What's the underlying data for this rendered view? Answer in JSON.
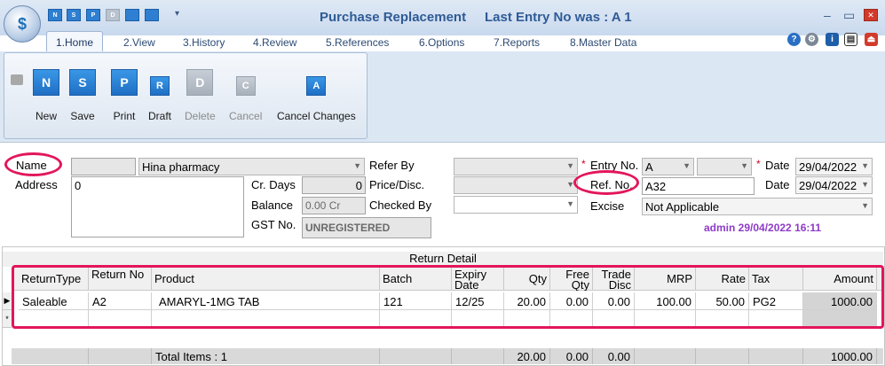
{
  "window": {
    "title": "Purchase Replacement",
    "last_entry": "Last Entry No was : A 1",
    "minimize": "–",
    "restore": "▭",
    "close": "✕"
  },
  "quick_access": [
    "N",
    "S",
    "P",
    "D",
    "",
    ""
  ],
  "tabs": [
    {
      "label": "1.Home",
      "active": true
    },
    {
      "label": "2.View"
    },
    {
      "label": "3.History"
    },
    {
      "label": "4.Review"
    },
    {
      "label": "5.References"
    },
    {
      "label": "6.Options"
    },
    {
      "label": "7.Reports"
    },
    {
      "label": "8.Master Data"
    }
  ],
  "tab_icons": [
    "help-icon",
    "settings-icon",
    "info-icon",
    "document-icon",
    "exit-icon"
  ],
  "ribbon": {
    "new": {
      "icon": "N",
      "label": "New"
    },
    "save": {
      "icon": "S",
      "label": "Save"
    },
    "print": {
      "icon": "P",
      "label": "Print"
    },
    "draft": {
      "icon": "R",
      "label": "Draft"
    },
    "delete": {
      "icon": "D",
      "label": "Delete"
    },
    "cancel": {
      "icon": "C",
      "label": "Cancel"
    },
    "cancel_changes": {
      "icon": "A",
      "label": "Cancel Changes"
    }
  },
  "form": {
    "name_label": "Name",
    "name_value": "Hina pharmacy",
    "address_label": "Address",
    "address_value": "0",
    "cr_days_label": "Cr. Days",
    "cr_days_value": "0",
    "balance_label": "Balance",
    "balance_value": "0.00 Cr",
    "gst_label": "GST No.",
    "gst_value": "UNREGISTERED",
    "refer_by_label": "Refer By",
    "price_disc_label": "Price/Disc.",
    "checked_by_label": "Checked By",
    "entry_no_label": "Entry No.",
    "entry_series": "A",
    "ref_no_label": "Ref. No.",
    "ref_no_value": "A32",
    "excise_label": "Excise",
    "excise_value": "Not Applicable",
    "date_label": "Date",
    "date_value": "29/04/2022",
    "date2_label": "Date",
    "date2_value": "29/04/2022",
    "admin_line": "admin 29/04/2022 16:11"
  },
  "grid": {
    "title": "Return Detail",
    "columns": [
      "ReturnType",
      "Return No",
      "Product",
      "Batch",
      "Expiry Date",
      "Qty",
      "Free Qty",
      "Trade Disc",
      "MRP",
      "Rate",
      "Tax",
      "Amount"
    ],
    "rows": [
      [
        "Saleable",
        "A2",
        "AMARYL-1MG TAB",
        "121",
        "12/25",
        "20.00",
        "0.00",
        "0.00",
        "100.00",
        "50.00",
        "PG2",
        "1000.00"
      ]
    ],
    "totals": {
      "label": "Total Items : 1",
      "qty": "20.00",
      "free": "0.00",
      "trade": "0.00",
      "amount": "1000.00"
    }
  },
  "colors": {
    "accent": "#2f5b96",
    "highlight": "#e3165b",
    "admin": "#8e3bc8"
  }
}
